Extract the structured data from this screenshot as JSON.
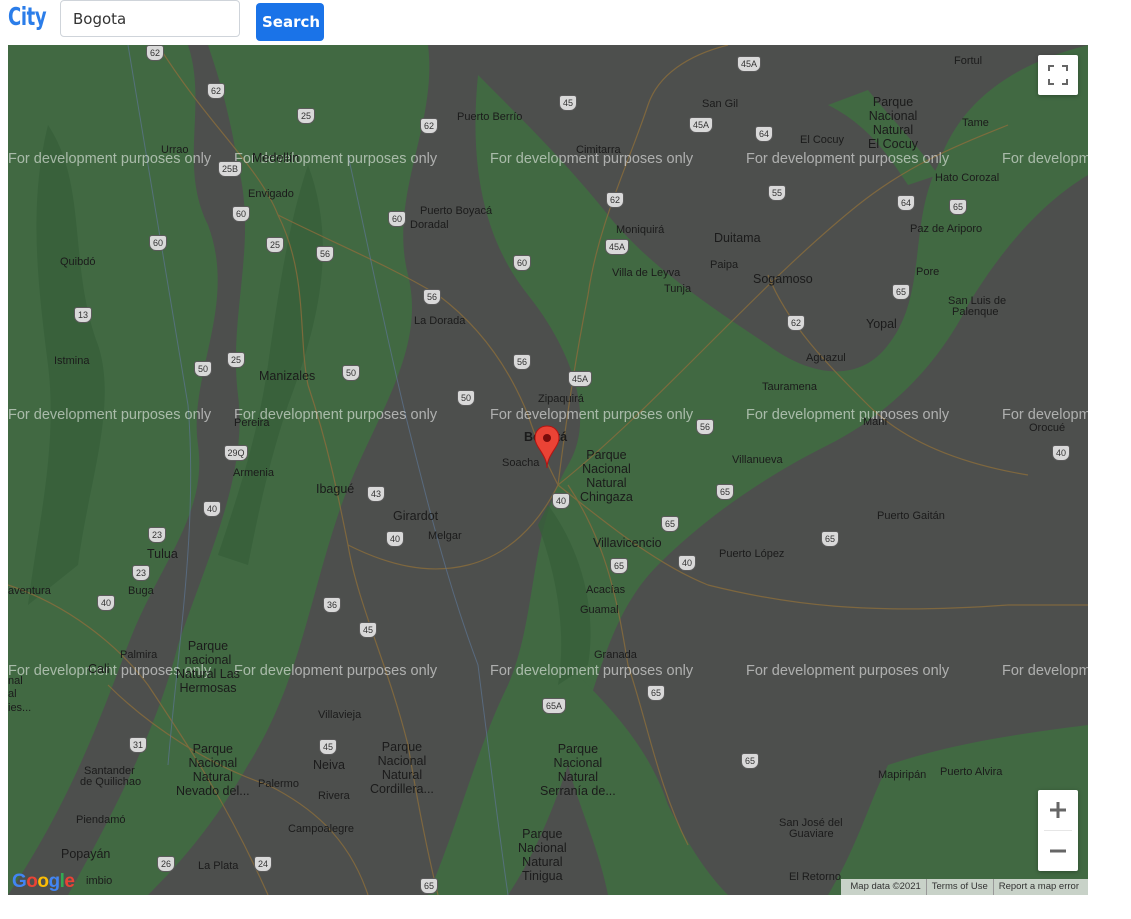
{
  "header": {
    "city_label": "City",
    "city_value": "Bogota",
    "search_label": "Search"
  },
  "map": {
    "watermark": "For development purposes only",
    "places": {
      "medellin": "Medellín",
      "envigado": "Envigado",
      "quibdo": "Quibdó",
      "istmina": "Istmina",
      "manizales": "Manizales",
      "pereira": "Pereira",
      "armenia": "Armenia",
      "ibague": "Ibagué",
      "tulua": "Tulua",
      "buga": "Buga",
      "palmira": "Palmira",
      "cali": "Cali",
      "aventura": "aventura",
      "popayan": "Popayán",
      "timbio": "imbio",
      "la_plata": "La Plata",
      "neiva": "Neiva",
      "palermo": "Palermo",
      "rivera": "Rivera",
      "campoalegre": "Campoalegre",
      "villavieja": "Villavieja",
      "piendamo": "Piendamó",
      "santander": "Santander",
      "de_quilichao": "de Quilichao",
      "girardot": "Girardot",
      "melgar": "Melgar",
      "la_dorada": "La Dorada",
      "puerto_boyaca": "Puerto Boyacá",
      "doradal": "Doradal",
      "puerto_berrio": "Puerto Berrío",
      "zipaquira": "Zipaquirá",
      "bogota": "Bogotá",
      "soacha": "Soacha",
      "villavicencio": "Villavicencio",
      "acacias": "Acacías",
      "guamal": "Guamal",
      "granada": "Granada",
      "puerto_lopez": "Puerto López",
      "puerto_gaitan": "Puerto Gaitán",
      "villanueva": "Villanueva",
      "aguazul": "Aguazul",
      "tauramena": "Tauramena",
      "yopal": "Yopal",
      "mani": "Maní",
      "orocue": "Orocué",
      "san_luis": "San Luis de",
      "palenque": "Palenque",
      "pore": "Pore",
      "paz_de_ariporo": "Paz de Ariporo",
      "hato_corozal": "Hato Corozal",
      "tame": "Tame",
      "fortul": "Fortul",
      "el_cocuy": "El Cocuy",
      "san_gil": "San Gil",
      "cimitarra": "Cimitarra",
      "moniquira": "Moniquirá",
      "duitama": "Duitama",
      "paipa": "Paipa",
      "sogamoso": "Sogamoso",
      "tunja": "Tunja",
      "villa_de_leyva": "Villa de Leyva",
      "mapiripan": "Mapiripán",
      "puerto_alvira": "Puerto Alvira",
      "san_jose": "San José del",
      "guaviare": "Guaviare",
      "el_retorno": "El Retorno",
      "urrao": "Urrao"
    },
    "parks": {
      "chingaza": [
        "Parque",
        "Nacional",
        "Natural",
        "Chingaza"
      ],
      "el_cocuy_park": [
        "Parque",
        "Nacional",
        "Natural",
        "El Cocuy"
      ],
      "las_hermosas": [
        "Parque",
        "nacional",
        "Natural Las",
        "Hermosas"
      ],
      "nevado": [
        "Parque",
        "Nacional",
        "Natural",
        "Nevado del..."
      ],
      "cordillera": [
        "Parque",
        "Nacional",
        "Natural",
        "Cordillera..."
      ],
      "serrania": [
        "Parque",
        "Nacional",
        "Natural",
        "Serranía de..."
      ],
      "tinigua": [
        "Parque",
        "Nacional",
        "Natural",
        "Tinigua"
      ]
    },
    "left_edge_text": [
      "nal",
      "al",
      "ies..."
    ],
    "attribution": {
      "map_data": "Map data ©2021",
      "terms": "Terms of Use",
      "report": "Report a map error"
    },
    "google_logo": "Google"
  }
}
